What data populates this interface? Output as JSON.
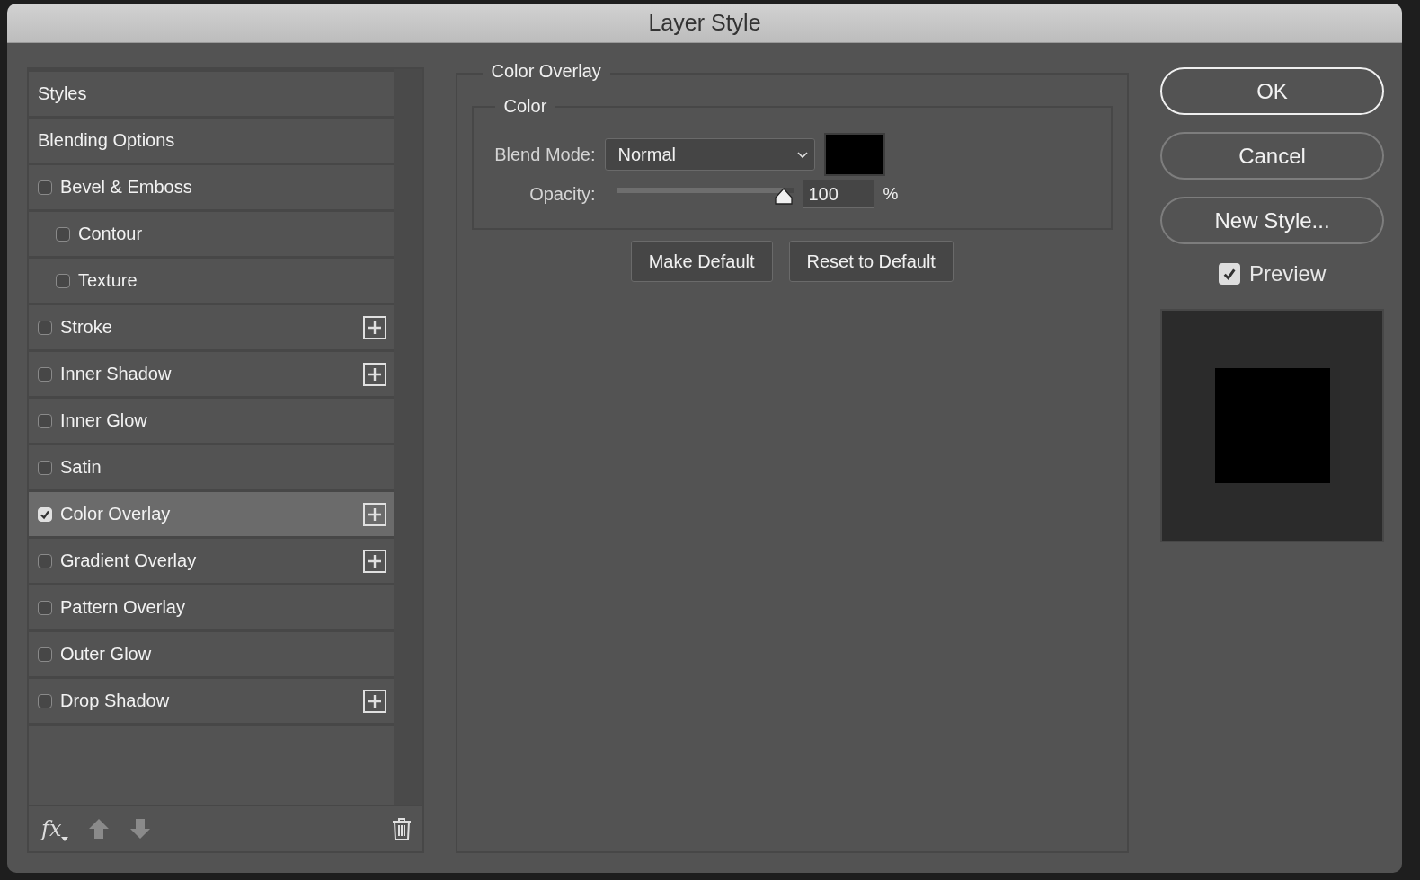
{
  "window": {
    "title": "Layer Style"
  },
  "styles": [
    {
      "label": "Styles",
      "kind": "header",
      "selected": false
    },
    {
      "label": "Blending Options",
      "kind": "header",
      "selected": false
    },
    {
      "label": "Bevel & Emboss",
      "kind": "effect",
      "checked": false,
      "selected": false,
      "addable": false,
      "children": [
        {
          "label": "Contour",
          "kind": "effect",
          "checked": false,
          "selected": false,
          "addable": false
        },
        {
          "label": "Texture",
          "kind": "effect",
          "checked": false,
          "selected": false,
          "addable": false
        }
      ]
    },
    {
      "label": "Stroke",
      "kind": "effect",
      "checked": false,
      "selected": false,
      "addable": true
    },
    {
      "label": "Inner Shadow",
      "kind": "effect",
      "checked": false,
      "selected": false,
      "addable": true
    },
    {
      "label": "Inner Glow",
      "kind": "effect",
      "checked": false,
      "selected": false,
      "addable": false
    },
    {
      "label": "Satin",
      "kind": "effect",
      "checked": false,
      "selected": false,
      "addable": false
    },
    {
      "label": "Color Overlay",
      "kind": "effect",
      "checked": true,
      "selected": true,
      "addable": true
    },
    {
      "label": "Gradient Overlay",
      "kind": "effect",
      "checked": false,
      "selected": false,
      "addable": true
    },
    {
      "label": "Pattern Overlay",
      "kind": "effect",
      "checked": false,
      "selected": false,
      "addable": false
    },
    {
      "label": "Outer Glow",
      "kind": "effect",
      "checked": false,
      "selected": false,
      "addable": false
    },
    {
      "label": "Drop Shadow",
      "kind": "effect",
      "checked": false,
      "selected": false,
      "addable": true
    }
  ],
  "styles_footer": {
    "fx_label": "fx",
    "move_up_disabled": true,
    "move_down_disabled": true
  },
  "panel": {
    "title": "Color Overlay",
    "group_title": "Color",
    "blend_mode": {
      "label": "Blend Mode:",
      "value": "Normal"
    },
    "swatch": {
      "color": "#000000"
    },
    "opacity": {
      "label": "Opacity:",
      "level": 1.0,
      "value": "100",
      "unit": "%"
    },
    "buttons": [
      "Make Default",
      "Reset to Default"
    ]
  },
  "actions": [
    {
      "label": "OK",
      "default": true
    },
    {
      "label": "Cancel",
      "default": false
    },
    {
      "label": "New Style...",
      "default": false
    }
  ],
  "preview": {
    "label": "Preview",
    "checked": true,
    "color": "#000000"
  }
}
